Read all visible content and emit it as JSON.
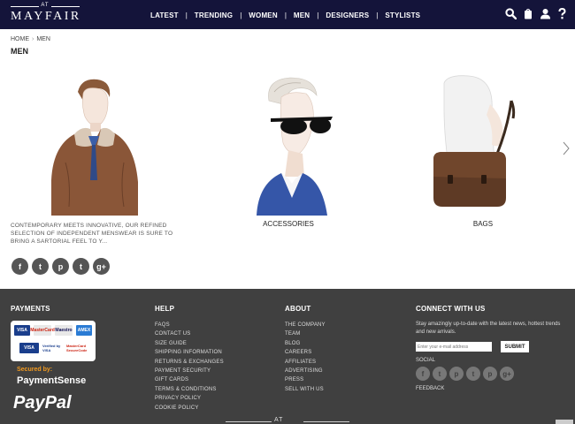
{
  "brand": {
    "at": "AT",
    "name": "MAYFAIR"
  },
  "nav": [
    "LATEST",
    "TRENDING",
    "WOMEN",
    "MEN",
    "DESIGNERS",
    "STYLISTS"
  ],
  "header_icons": [
    "search-icon",
    "bag-icon",
    "user-icon",
    "help-icon"
  ],
  "breadcrumb": {
    "home": "HOME",
    "sep": "›",
    "current": "MEN"
  },
  "page_title": "MEN",
  "intro": "CONTEMPORARY MEETS INNOVATIVE, OUR REFINED SELECTION OF INDEPENDENT MENSWEAR IS SURE TO BRING A SARTORIAL FEEL TO Y...",
  "panels": [
    {
      "label": "ACCESSORIES"
    },
    {
      "label": "BAGS"
    }
  ],
  "social": [
    "f",
    "t",
    "p",
    "t",
    "g+"
  ],
  "footer": {
    "payments": {
      "heading": "PAYMENTS",
      "cards": [
        "VISA",
        "MasterCard",
        "Maestro",
        "AMEX",
        "VISA",
        "Verified by VISA",
        "MasterCard SecureCode"
      ],
      "secured_by": "Secured by:",
      "paymentsense": "PaymentSense",
      "paypal": "PayPal"
    },
    "help": {
      "heading": "HELP",
      "links": [
        "FAQS",
        "CONTACT US",
        "SIZE GUIDE",
        "SHIPPING INFORMATION",
        "RETURNS & EXCHANGES",
        "PAYMENT SECURITY",
        "GIFT CARDS",
        "TERMS & CONDITIONS",
        "PRIVACY POLICY",
        "COOKIE POLICY"
      ]
    },
    "about": {
      "heading": "ABOUT",
      "links": [
        "THE COMPANY",
        "TEAM",
        "BLOG",
        "CAREERS",
        "AFFILIATES",
        "ADVERTISING",
        "PRESS",
        "SELL WITH US"
      ]
    },
    "connect": {
      "heading": "CONNECT WITH US",
      "text": "Stay amazingly up-to-date with the latest news, hottest trends and new arrivals.",
      "email_placeholder": "Enter your e-mail address",
      "submit": "SUBMIT",
      "social_label": "SOCIAL",
      "social": [
        "f",
        "t",
        "p",
        "t",
        "p",
        "g+"
      ],
      "feedback": "FEEDBACK"
    },
    "logo_at": "AT"
  },
  "colors": {
    "header_bg": "#14143a",
    "footer_bg": "#404040",
    "paymentsense_orange": "#f29a1f"
  }
}
